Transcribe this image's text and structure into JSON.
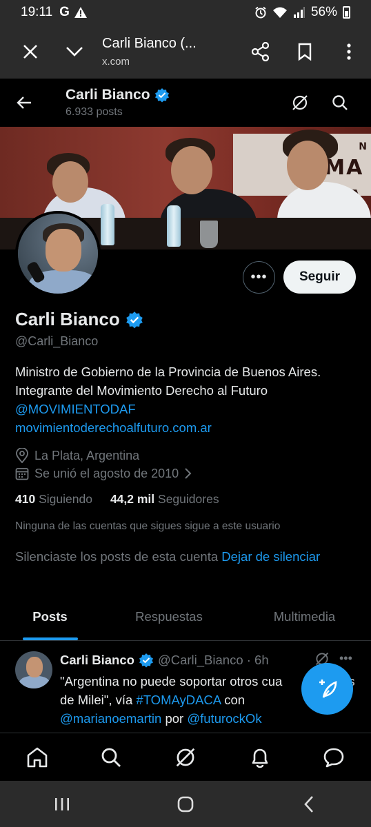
{
  "status_bar": {
    "time": "19:11",
    "left_icons": [
      "G",
      "warning-icon"
    ],
    "right_icons": [
      "alarm-icon",
      "wifi-icon",
      "signal-icon"
    ],
    "battery": "56%"
  },
  "browser": {
    "title": "Carli Bianco (...",
    "domain": "x.com"
  },
  "header": {
    "name": "Carli Bianco",
    "posts_count": "6.933 posts"
  },
  "banner": {
    "sign_text_lines": [
      "N",
      "MA",
      "MA"
    ]
  },
  "profile": {
    "name": "Carli Bianco",
    "handle": "@Carli_Bianco",
    "bio_line1": "Ministro de Gobierno de la Provincia de Buenos Aires. Integrante del Movimiento Derecho al Futuro",
    "bio_mention": "@MOVIMIENTODAF",
    "bio_link": "movimientoderechoalfuturo.com.ar",
    "location": "La Plata, Argentina",
    "joined": "Se unió el agosto de 2010",
    "following_count": "410",
    "following_label": "Siguiendo",
    "followers_count": "44,2 mil",
    "followers_label": "Seguidores",
    "followers_note": "Ninguna de las cuentas que sigues sigue a este usuario",
    "muted_text": "Silenciaste los posts de esta cuenta",
    "unmute_label": "Dejar de silenciar",
    "follow_label": "Seguir",
    "more_label": "•••"
  },
  "tabs": [
    {
      "label": "Posts",
      "active": true
    },
    {
      "label": "Respuestas",
      "active": false
    },
    {
      "label": "Multimedia",
      "active": false
    }
  ],
  "post": {
    "name": "Carli Bianco",
    "handle_time": "@Carli_Bianco · 6h",
    "text_part1": "\"Argentina no puede soportar otros cua",
    "text_part1b": "s",
    "text_line2_start": "de Milei\", vía ",
    "hashtag": "#TOMAyDACA",
    "text_con": " con",
    "mention1": "@marianoemartin",
    "text_por": " por ",
    "mention2": "@futurockOk"
  },
  "bottom_nav": [
    "home-icon",
    "search-icon",
    "grok-icon",
    "bell-icon",
    "messages-icon"
  ],
  "colors": {
    "accent": "#1d9bf0",
    "background": "#000000",
    "text_primary": "#e7e9ea",
    "text_secondary": "#71767b",
    "chrome": "#2b2b2b"
  }
}
